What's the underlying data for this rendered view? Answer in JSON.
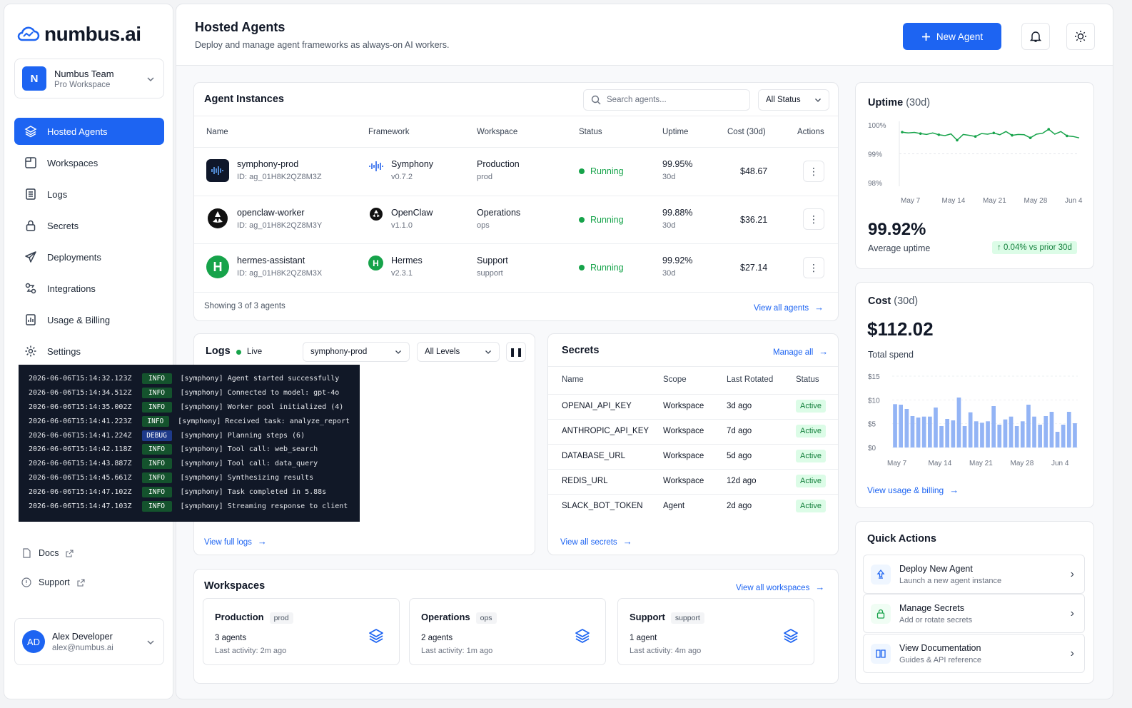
{
  "brand": {
    "name": "numbus.ai"
  },
  "team": {
    "initial": "N",
    "name": "Numbus Team",
    "plan": "Pro Workspace"
  },
  "nav": [
    {
      "label": "Hosted Agents",
      "icon": "layers-icon"
    },
    {
      "label": "Workspaces",
      "icon": "workspace-icon"
    },
    {
      "label": "Logs",
      "icon": "logs-icon"
    },
    {
      "label": "Secrets",
      "icon": "lock-icon"
    },
    {
      "label": "Deployments",
      "icon": "send-icon"
    },
    {
      "label": "Integrations",
      "icon": "integration-icon"
    },
    {
      "label": "Usage & Billing",
      "icon": "billing-icon"
    },
    {
      "label": "Settings",
      "icon": "gear-icon"
    }
  ],
  "links": {
    "docs": "Docs",
    "support": "Support"
  },
  "user": {
    "initials": "AD",
    "name": "Alex Developer",
    "email": "alex@numbus.ai"
  },
  "header": {
    "title": "Hosted Agents",
    "subtitle": "Deploy and manage agent frameworks as always-on AI workers.",
    "new_agent": "New Agent"
  },
  "instances": {
    "title": "Agent Instances",
    "search_placeholder": "Search agents...",
    "status_filter": "All Status",
    "columns": [
      "Name",
      "Framework",
      "Workspace",
      "Status",
      "Uptime",
      "Cost (30d)",
      "Actions"
    ],
    "rows": [
      {
        "name": "symphony-prod",
        "id": "ID: ag_01H8K2QZ8M3Z",
        "framework": "Symphony",
        "version": "v0.7.2",
        "workspace": "Production",
        "ws_slug": "prod",
        "status": "Running",
        "uptime": "99.95%",
        "uptime_period": "30d",
        "cost": "$48.67"
      },
      {
        "name": "openclaw-worker",
        "id": "ID: ag_01H8K2QZ8M3Y",
        "framework": "OpenClaw",
        "version": "v1.1.0",
        "workspace": "Operations",
        "ws_slug": "ops",
        "status": "Running",
        "uptime": "99.88%",
        "uptime_period": "30d",
        "cost": "$36.21"
      },
      {
        "name": "hermes-assistant",
        "id": "ID: ag_01H8K2QZ8M3X",
        "framework": "Hermes",
        "version": "v2.3.1",
        "workspace": "Support",
        "ws_slug": "support",
        "status": "Running",
        "uptime": "99.92%",
        "uptime_period": "30d",
        "cost": "$27.14"
      }
    ],
    "footer": "Showing 3 of 3 agents",
    "view_all": "View all agents"
  },
  "logs": {
    "title": "Logs",
    "live": "Live",
    "agent_filter": "symphony-prod",
    "level_filter": "All Levels",
    "lines": [
      {
        "ts": "2026-06-06T15:14:32.123Z",
        "level": "INFO",
        "msg": "[symphony] Agent started successfully"
      },
      {
        "ts": "2026-06-06T15:14:34.512Z",
        "level": "INFO",
        "msg": "[symphony] Connected to model: gpt-4o"
      },
      {
        "ts": "2026-06-06T15:14:35.002Z",
        "level": "INFO",
        "msg": "[symphony] Worker pool initialized (4)"
      },
      {
        "ts": "2026-06-06T15:14:41.223Z",
        "level": "INFO",
        "msg": "[symphony] Received task: analyze_report"
      },
      {
        "ts": "2026-06-06T15:14:41.224Z",
        "level": "DEBUG",
        "msg": "[symphony] Planning steps (6)"
      },
      {
        "ts": "2026-06-06T15:14:42.118Z",
        "level": "INFO",
        "msg": "[symphony] Tool call: web_search"
      },
      {
        "ts": "2026-06-06T15:14:43.887Z",
        "level": "INFO",
        "msg": "[symphony] Tool call: data_query"
      },
      {
        "ts": "2026-06-06T15:14:45.661Z",
        "level": "INFO",
        "msg": "[symphony] Synthesizing results"
      },
      {
        "ts": "2026-06-06T15:14:47.102Z",
        "level": "INFO",
        "msg": "[symphony] Task completed in 5.88s"
      },
      {
        "ts": "2026-06-06T15:14:47.103Z",
        "level": "INFO",
        "msg": "[symphony] Streaming response to client"
      }
    ],
    "view_full": "View full logs"
  },
  "secrets": {
    "title": "Secrets",
    "manage": "Manage all",
    "columns": [
      "Name",
      "Scope",
      "Last Rotated",
      "Status"
    ],
    "rows": [
      {
        "name": "OPENAI_API_KEY",
        "scope": "Workspace",
        "rotated": "3d ago",
        "status": "Active"
      },
      {
        "name": "ANTHROPIC_API_KEY",
        "scope": "Workspace",
        "rotated": "7d ago",
        "status": "Active"
      },
      {
        "name": "DATABASE_URL",
        "scope": "Workspace",
        "rotated": "5d ago",
        "status": "Active"
      },
      {
        "name": "REDIS_URL",
        "scope": "Workspace",
        "rotated": "12d ago",
        "status": "Active"
      },
      {
        "name": "SLACK_BOT_TOKEN",
        "scope": "Agent",
        "rotated": "2d ago",
        "status": "Active"
      }
    ],
    "view_all": "View all secrets"
  },
  "workspaces": {
    "title": "Workspaces",
    "view_all": "View all workspaces",
    "items": [
      {
        "name": "Production",
        "slug": "prod",
        "agents": "3 agents",
        "activity": "Last activity: 2m ago"
      },
      {
        "name": "Operations",
        "slug": "ops",
        "agents": "2 agents",
        "activity": "Last activity: 1m ago"
      },
      {
        "name": "Support",
        "slug": "support",
        "agents": "1 agent",
        "activity": "Last activity: 4m ago"
      }
    ]
  },
  "uptime": {
    "title": "Uptime",
    "period": "(30d)",
    "value": "99.92%",
    "label": "Average uptime",
    "delta": "0.04% vs prior 30d"
  },
  "cost": {
    "title": "Cost",
    "period": "(30d)",
    "value": "$112.02",
    "label": "Total spend",
    "link": "View usage & billing"
  },
  "quick_actions": {
    "title": "Quick Actions",
    "items": [
      {
        "title": "Deploy New Agent",
        "sub": "Launch a new agent instance"
      },
      {
        "title": "Manage Secrets",
        "sub": "Add or rotate secrets"
      },
      {
        "title": "View Documentation",
        "sub": "Guides & API reference"
      }
    ]
  },
  "colors": {
    "accent": "#1d64f2",
    "success": "#16a34a",
    "chart_line": "#16a34a",
    "chart_bar": "#93b4f5"
  },
  "chart_data": [
    {
      "type": "line",
      "title": "Uptime (30d)",
      "ylim": [
        98,
        100
      ],
      "yticks": [
        "98%",
        "99%",
        "100%"
      ],
      "xticks": [
        "May 7",
        "May 14",
        "May 21",
        "May 28",
        "Jun 4"
      ],
      "series": [
        {
          "values": [
            99.75,
            99.72,
            99.74,
            99.7,
            99.67,
            99.72,
            99.66,
            99.63,
            99.69,
            99.47,
            99.67,
            99.64,
            99.6,
            99.7,
            99.68,
            99.72,
            99.66,
            99.77,
            99.64,
            99.67,
            99.66,
            99.55,
            99.68,
            99.71,
            99.85,
            99.68,
            99.77,
            99.62,
            99.6,
            99.55
          ]
        }
      ]
    },
    {
      "type": "bar",
      "title": "Cost (30d)",
      "ylim": [
        0,
        15
      ],
      "yticks": [
        "$0",
        "$5",
        "$10",
        "$15"
      ],
      "xticks": [
        "May 7",
        "May 14",
        "May 21",
        "May 28",
        "Jun 4"
      ],
      "series": [
        {
          "values": [
            9.1,
            9.0,
            8.1,
            6.6,
            6.3,
            6.5,
            6.5,
            8.4,
            4.5,
            6.0,
            5.7,
            10.5,
            4.5,
            7.4,
            5.5,
            5.2,
            5.5,
            8.7,
            4.8,
            5.9,
            6.5,
            4.5,
            5.5,
            9.0,
            6.5,
            4.8,
            6.6,
            7.5,
            3.3,
            4.8,
            7.5,
            5.1
          ]
        }
      ]
    }
  ]
}
